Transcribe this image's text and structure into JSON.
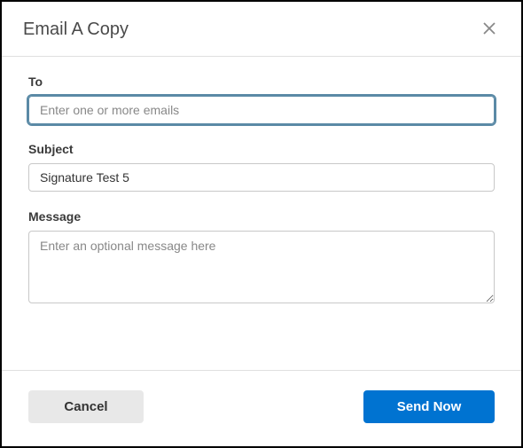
{
  "dialog": {
    "title": "Email A Copy"
  },
  "form": {
    "to": {
      "label": "To",
      "placeholder": "Enter one or more emails",
      "value": ""
    },
    "subject": {
      "label": "Subject",
      "value": "Signature Test 5"
    },
    "message": {
      "label": "Message",
      "placeholder": "Enter an optional message here",
      "value": ""
    }
  },
  "actions": {
    "cancel": "Cancel",
    "send": "Send Now"
  }
}
